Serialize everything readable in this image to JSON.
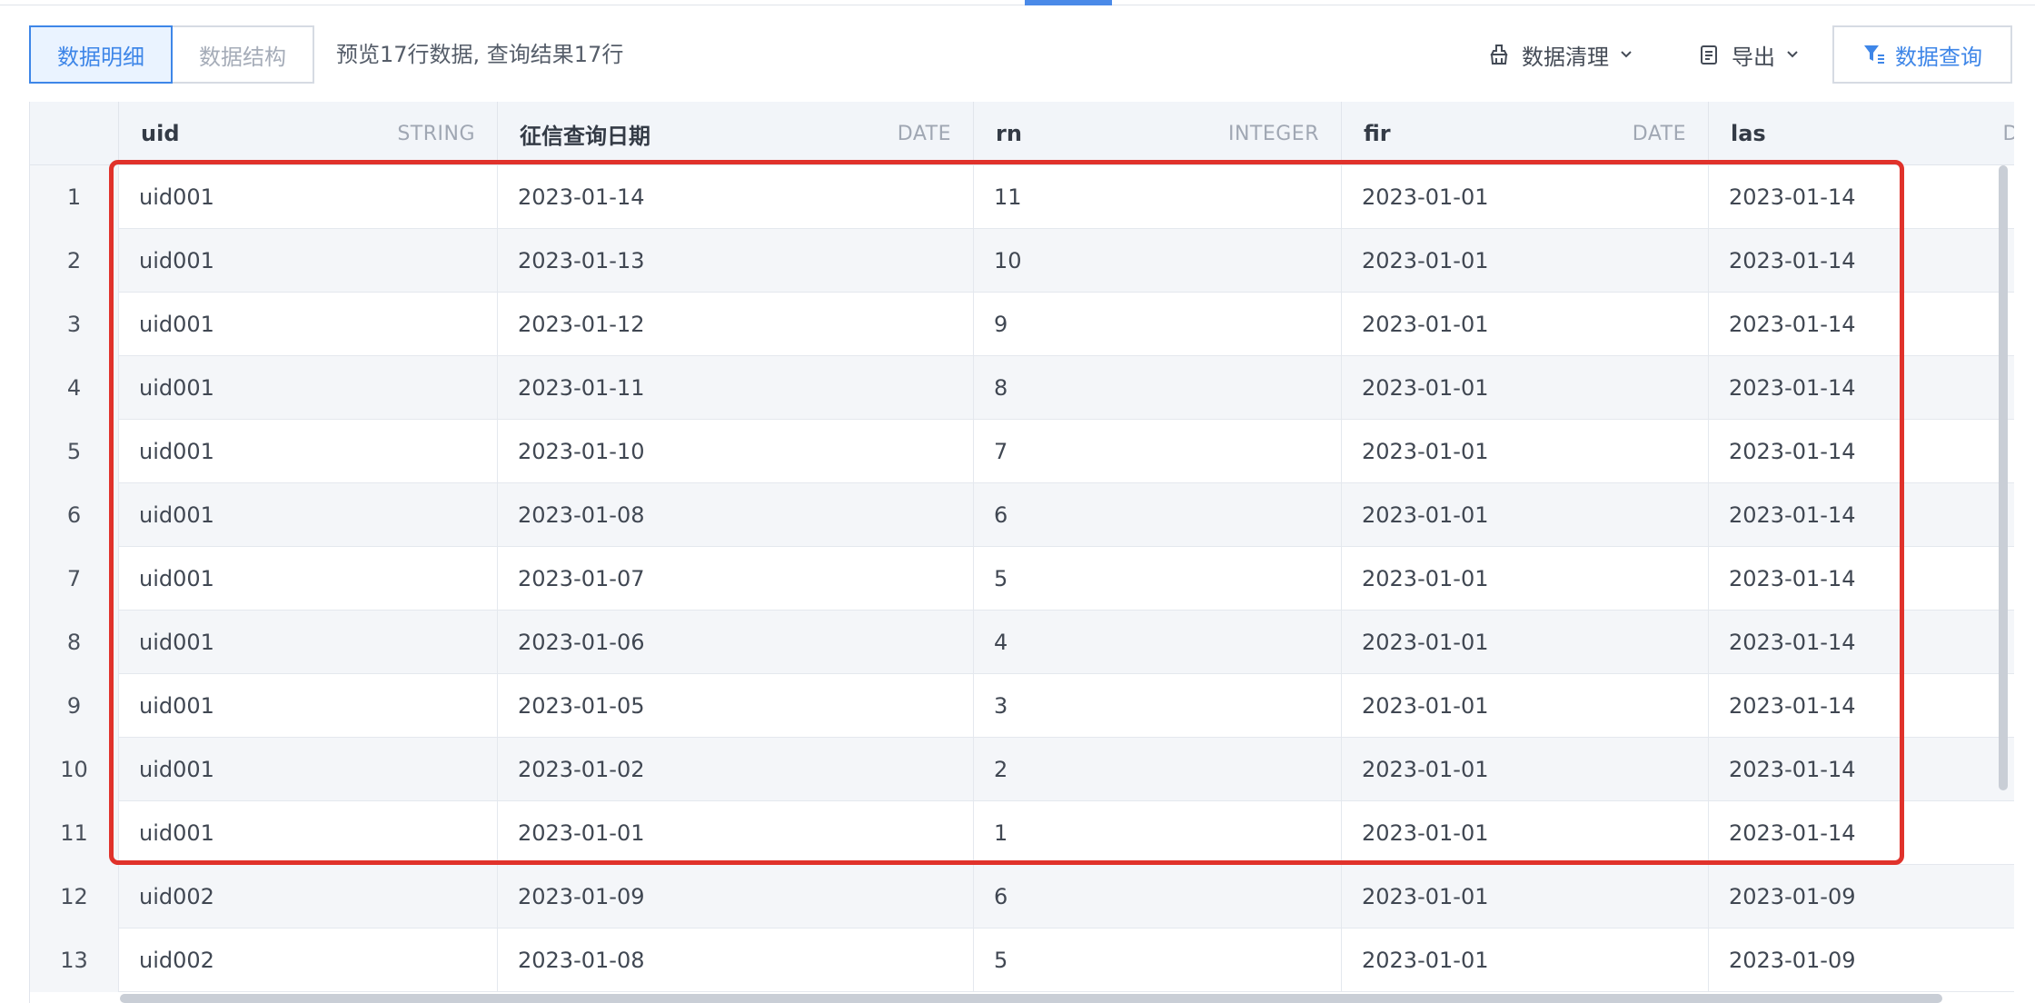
{
  "tabs": {
    "detail_label": "数据明细",
    "structure_label": "数据结构"
  },
  "preview_text": "预览17行数据, 查询结果17行",
  "toolbar": {
    "clean_label": "数据清理",
    "export_label": "导出",
    "query_label": "数据查询"
  },
  "icons": {
    "clean": "broom-icon",
    "export": "document-icon",
    "query": "filter-icon",
    "chevron": "chevron-down-icon"
  },
  "colors": {
    "accent": "#3e86e8",
    "highlight": "#e0322b"
  },
  "table": {
    "columns": [
      {
        "name": "uid",
        "type": "STRING"
      },
      {
        "name": "征信查询日期",
        "type": "DATE"
      },
      {
        "name": "rn",
        "type": "INTEGER"
      },
      {
        "name": "fir",
        "type": "DATE"
      },
      {
        "name": "las",
        "type": "D"
      }
    ],
    "rows": [
      {
        "index": "1",
        "uid": "uid001",
        "date": "2023-01-14",
        "rn": "11",
        "fir": "2023-01-01",
        "las": "2023-01-14"
      },
      {
        "index": "2",
        "uid": "uid001",
        "date": "2023-01-13",
        "rn": "10",
        "fir": "2023-01-01",
        "las": "2023-01-14"
      },
      {
        "index": "3",
        "uid": "uid001",
        "date": "2023-01-12",
        "rn": "9",
        "fir": "2023-01-01",
        "las": "2023-01-14"
      },
      {
        "index": "4",
        "uid": "uid001",
        "date": "2023-01-11",
        "rn": "8",
        "fir": "2023-01-01",
        "las": "2023-01-14"
      },
      {
        "index": "5",
        "uid": "uid001",
        "date": "2023-01-10",
        "rn": "7",
        "fir": "2023-01-01",
        "las": "2023-01-14"
      },
      {
        "index": "6",
        "uid": "uid001",
        "date": "2023-01-08",
        "rn": "6",
        "fir": "2023-01-01",
        "las": "2023-01-14"
      },
      {
        "index": "7",
        "uid": "uid001",
        "date": "2023-01-07",
        "rn": "5",
        "fir": "2023-01-01",
        "las": "2023-01-14"
      },
      {
        "index": "8",
        "uid": "uid001",
        "date": "2023-01-06",
        "rn": "4",
        "fir": "2023-01-01",
        "las": "2023-01-14"
      },
      {
        "index": "9",
        "uid": "uid001",
        "date": "2023-01-05",
        "rn": "3",
        "fir": "2023-01-01",
        "las": "2023-01-14"
      },
      {
        "index": "10",
        "uid": "uid001",
        "date": "2023-01-02",
        "rn": "2",
        "fir": "2023-01-01",
        "las": "2023-01-14"
      },
      {
        "index": "11",
        "uid": "uid001",
        "date": "2023-01-01",
        "rn": "1",
        "fir": "2023-01-01",
        "las": "2023-01-14"
      },
      {
        "index": "12",
        "uid": "uid002",
        "date": "2023-01-09",
        "rn": "6",
        "fir": "2023-01-01",
        "las": "2023-01-09"
      },
      {
        "index": "13",
        "uid": "uid002",
        "date": "2023-01-08",
        "rn": "5",
        "fir": "2023-01-01",
        "las": "2023-01-09"
      }
    ]
  }
}
